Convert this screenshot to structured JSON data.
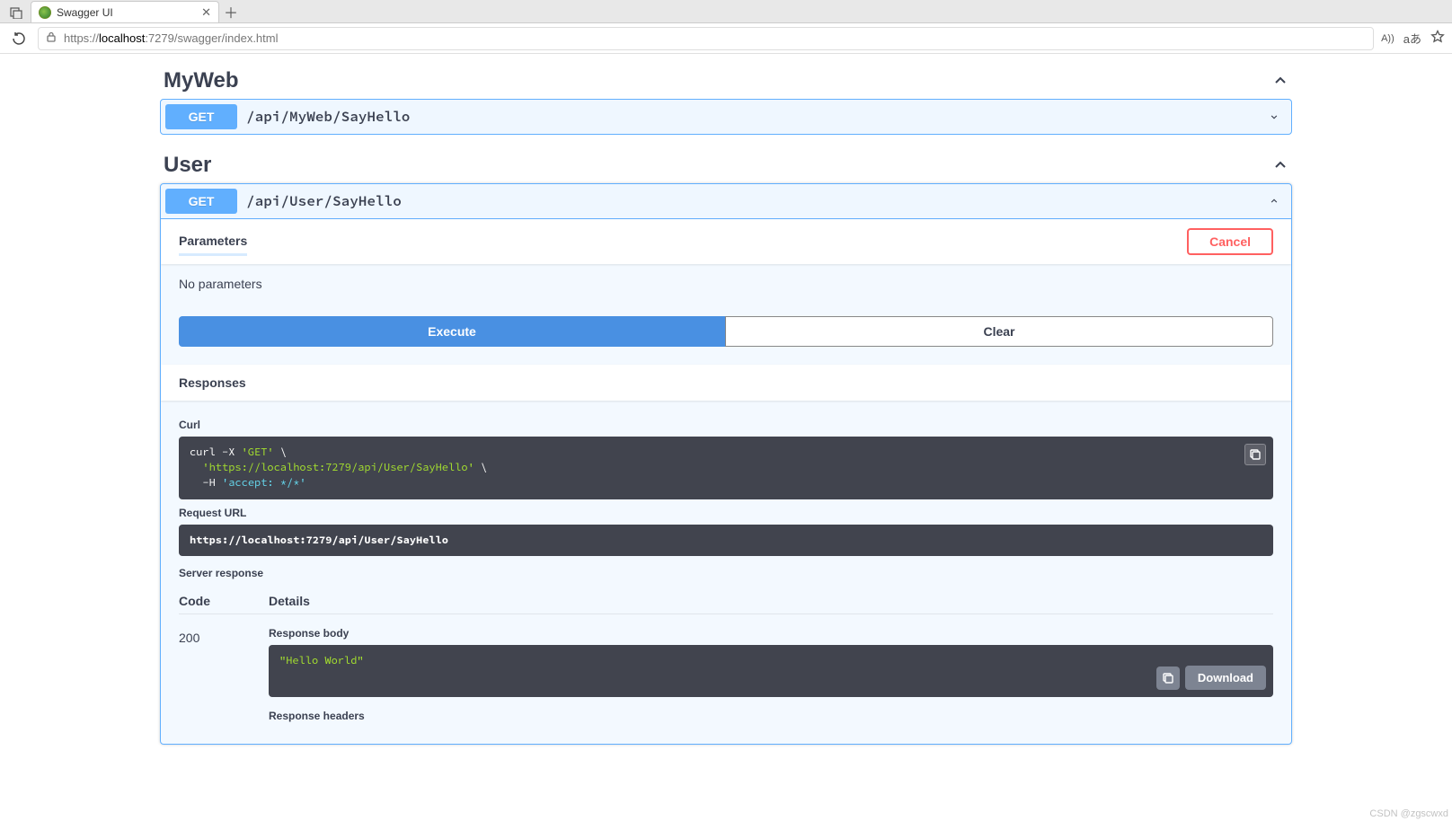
{
  "browser": {
    "tab_title": "Swagger UI",
    "url_prefix": "https://",
    "url_host": "localhost",
    "url_port_path": ":7279/swagger/index.html",
    "translate_label": "aあ",
    "voice_label": "A))"
  },
  "tags": {
    "myweb": {
      "name": "MyWeb",
      "op": {
        "method": "GET",
        "path": "/api/MyWeb/SayHello"
      }
    },
    "user": {
      "name": "User",
      "op": {
        "method": "GET",
        "path": "/api/User/SayHello"
      },
      "parameters_label": "Parameters",
      "cancel_label": "Cancel",
      "no_parameters": "No parameters",
      "execute_label": "Execute",
      "clear_label": "Clear",
      "responses_label": "Responses",
      "curl_label": "Curl",
      "curl_line1_a": "curl -X ",
      "curl_line1_b": "'GET'",
      "curl_line1_c": " \\",
      "curl_line2_a": "  ",
      "curl_line2_b": "'https://localhost:7279/api/User/SayHello'",
      "curl_line2_c": " \\",
      "curl_line3_a": "  -H ",
      "curl_line3_b": "'accept: */*'",
      "request_url_label": "Request URL",
      "request_url": "https://localhost:7279/api/User/SayHello",
      "server_response_label": "Server response",
      "code_header": "Code",
      "details_header": "Details",
      "status_code": "200",
      "response_body_label": "Response body",
      "response_body": "\"Hello World\"",
      "download_label": "Download",
      "response_headers_label": "Response headers"
    }
  },
  "watermark": "CSDN @zgscwxd"
}
